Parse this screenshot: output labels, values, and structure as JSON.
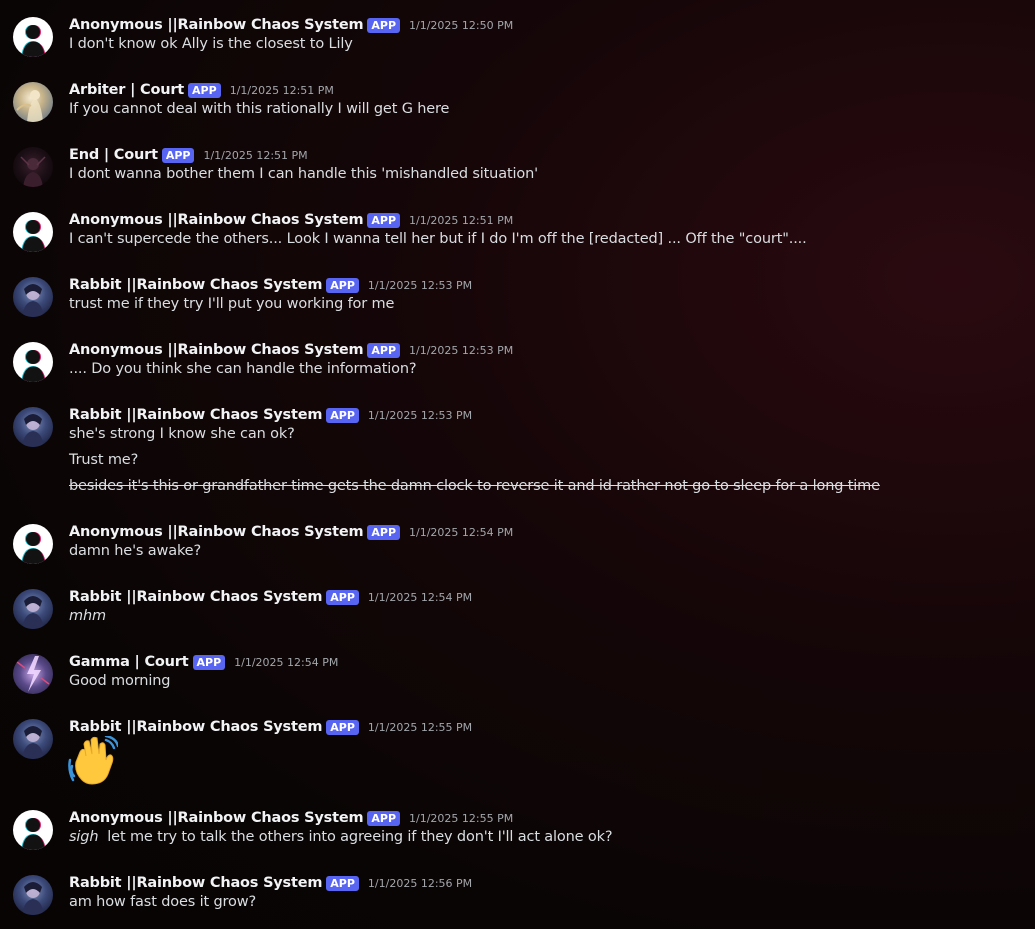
{
  "badge_label": "APP",
  "avatars": {
    "anon": "glitch-silhouette-avatar",
    "arbiter": "golden-figure-avatar",
    "end": "dark-figure-avatar",
    "rabbit": "dark-anime-avatar",
    "gamma": "lightning-avatar"
  },
  "colors": {
    "badge": "#5865f2",
    "username": "#f2f3f5",
    "message_text": "#dbdee1",
    "timestamp": "#a3a6aa"
  },
  "messages": [
    {
      "author": "Anonymous ||Rainbow Chaos System",
      "timestamp": "1/1/2025 12:50 PM",
      "lines": [
        "I don't know ok Ally is the closest  to Lily"
      ]
    },
    {
      "author": "Arbiter | Court",
      "timestamp": "1/1/2025 12:51 PM",
      "lines": [
        "If you cannot deal with this rationally I will get G here"
      ]
    },
    {
      "author": "End | Court",
      "timestamp": "1/1/2025 12:51 PM",
      "lines": [
        "I dont wanna bother them I can handle this 'mishandled situation'"
      ]
    },
    {
      "author": "Anonymous ||Rainbow Chaos System",
      "timestamp": "1/1/2025 12:51 PM",
      "lines": [
        "I can't supercede the others... Look I wanna tell her but if I do I'm off the [redacted]  ... Off the \"court\"...."
      ]
    },
    {
      "author": "Rabbit ||Rainbow Chaos System",
      "timestamp": "1/1/2025 12:53 PM",
      "lines": [
        "trust me if they try I'll put you working for me"
      ]
    },
    {
      "author": "Anonymous ||Rainbow Chaos System",
      "timestamp": "1/1/2025 12:53 PM",
      "lines": [
        ".... Do you think she can handle the information?"
      ]
    },
    {
      "author": "Rabbit ||Rainbow Chaos System",
      "timestamp": "1/1/2025 12:53 PM",
      "lines": [
        "she's strong I know she can ok?",
        "Trust me?",
        "besides it's this or grandfather time gets the damn clock to reverse it and id rather not go to sleep for a long time"
      ]
    },
    {
      "author": "Anonymous ||Rainbow Chaos System",
      "timestamp": "1/1/2025 12:54 PM",
      "lines": [
        "damn he's awake?"
      ]
    },
    {
      "author": "Rabbit ||Rainbow Chaos System",
      "timestamp": "1/1/2025 12:54 PM",
      "lines": [
        "mhm"
      ]
    },
    {
      "author": "Gamma | Court",
      "timestamp": "1/1/2025 12:54 PM",
      "lines": [
        "Good morning"
      ]
    },
    {
      "author": "Rabbit ||Rainbow Chaos System",
      "timestamp": "1/1/2025 12:55 PM",
      "emoji": "waving-hand-emoji"
    },
    {
      "author": "Anonymous ||Rainbow Chaos System",
      "timestamp": "1/1/2025 12:55 PM",
      "italic_prefix": "sigh",
      "lines": [
        "  let me try to talk the others into agreeing if they don't I'll act alone ok?"
      ]
    },
    {
      "author": "Rabbit ||Rainbow Chaos System",
      "timestamp": "1/1/2025 12:56 PM",
      "lines": [
        "am how fast does it grow?"
      ]
    }
  ]
}
